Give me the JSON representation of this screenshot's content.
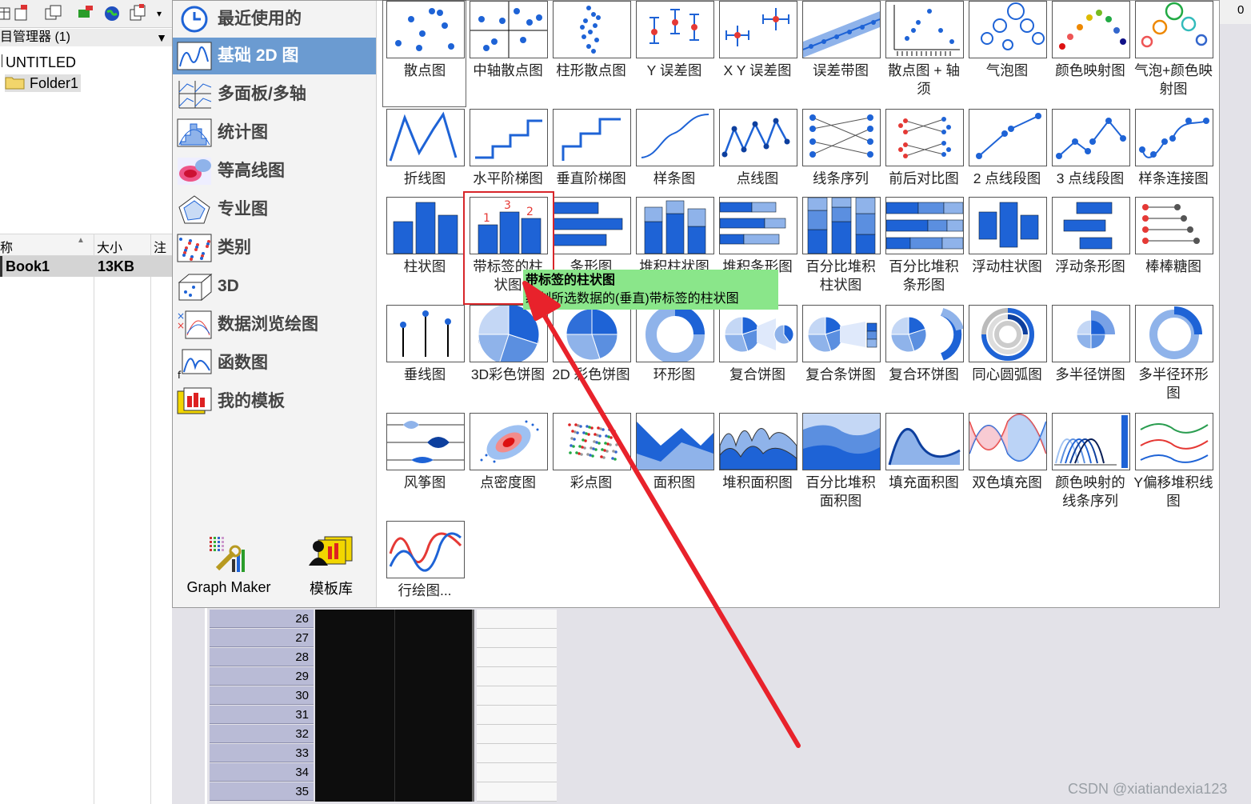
{
  "project_explorer": {
    "title": "目管理器 (1)",
    "root": "UNTITLED",
    "folder": "Folder1",
    "columns": [
      "称",
      "大小",
      "注释"
    ],
    "items": [
      {
        "name": "Book1",
        "size": "13KB"
      }
    ]
  },
  "worksheet": {
    "rows": [
      "26",
      "27",
      "28",
      "29",
      "30",
      "31",
      "32",
      "33",
      "34",
      "35"
    ]
  },
  "categories": [
    {
      "label": "最近使用的",
      "icon": "clock-icon"
    },
    {
      "label": "基础 2D 图",
      "icon": "line-chart-icon",
      "selected": true
    },
    {
      "label": "多面板/多轴",
      "icon": "multipanel-icon"
    },
    {
      "label": "统计图",
      "icon": "histogram-icon"
    },
    {
      "label": "等高线图",
      "icon": "contour-icon"
    },
    {
      "label": "专业图",
      "icon": "radar-icon"
    },
    {
      "label": "类别",
      "icon": "category-icon"
    },
    {
      "label": "3D",
      "icon": "cube-icon"
    },
    {
      "label": "数据浏览绘图",
      "icon": "data-explore-icon"
    },
    {
      "label": "函数图",
      "icon": "function-icon"
    },
    {
      "label": "我的模板",
      "icon": "template-icon"
    }
  ],
  "bottom_tools": [
    {
      "label": "Graph Maker"
    },
    {
      "label": "模板库"
    }
  ],
  "chart_tiles": [
    "散点图",
    "中轴散点图",
    "柱形散点图",
    "Y 误差图",
    "X Y 误差图",
    "误差带图",
    "散点图 + 轴须",
    "气泡图",
    "颜色映射图",
    "气泡+颜色映射图",
    "折线图",
    "水平阶梯图",
    "垂直阶梯图",
    "样条图",
    "点线图",
    "线条序列",
    "前后对比图",
    "2 点线段图",
    "3 点线段图",
    "样条连接图",
    "柱状图",
    "带标签的柱状图",
    "条形图",
    "堆积柱状图",
    "堆积条形图",
    "百分比堆积柱状图",
    "百分比堆积条形图",
    "浮动柱状图",
    "浮动条形图",
    "棒棒糖图",
    "垂线图",
    "3D彩色饼图",
    "2D 彩色饼图",
    "环形图",
    "复合饼图",
    "复合条饼图",
    "复合环饼图",
    "同心圆弧图",
    "多半径饼图",
    "多半径环形图",
    "风筝图",
    "点密度图",
    "彩点图",
    "面积图",
    "堆积面积图",
    "百分比堆积面积图",
    "填充面积图",
    "双色填充图",
    "颜色映射的线条序列",
    "Y偏移堆积线图",
    "行绘图..."
  ],
  "tooltip": {
    "title": "带标签的柱状图",
    "desc": "绘制所选数据的(垂直)带标签的柱状图"
  },
  "watermark": "CSDN @xiatiandexia123",
  "colors": {
    "accent": "#6b9bd1",
    "chart_blue": "#1e63d6",
    "tooltip_bg": "#8ae68a",
    "highlight": "#d8262a"
  }
}
